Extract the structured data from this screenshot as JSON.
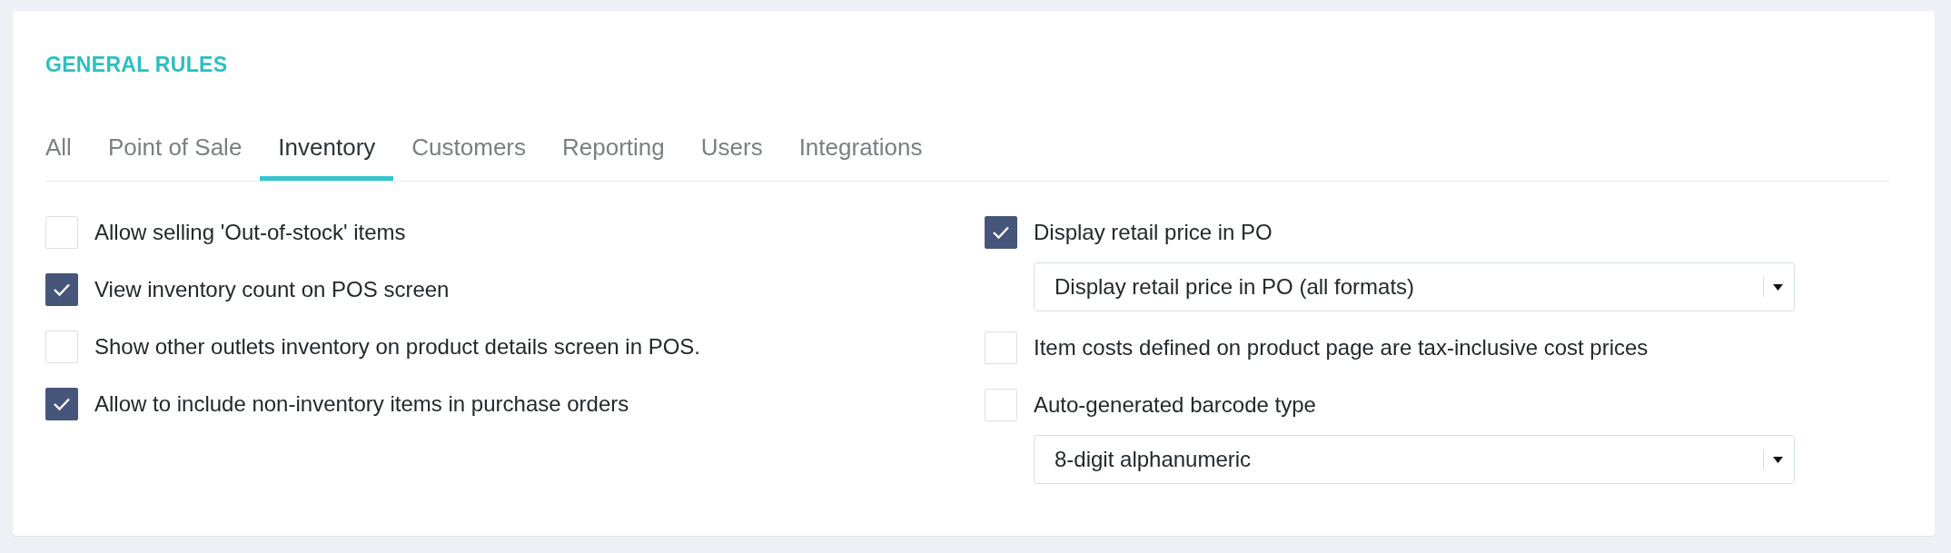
{
  "title": "GENERAL RULES",
  "tabs": [
    {
      "label": "All",
      "selected": false
    },
    {
      "label": "Point of Sale",
      "selected": false
    },
    {
      "label": "Inventory",
      "selected": true
    },
    {
      "label": "Customers",
      "selected": false
    },
    {
      "label": "Reporting",
      "selected": false
    },
    {
      "label": "Users",
      "selected": false
    },
    {
      "label": "Integrations",
      "selected": false
    }
  ],
  "left_options": [
    {
      "label": "Allow selling 'Out-of-stock' items",
      "checked": false
    },
    {
      "label": "View inventory count on POS screen",
      "checked": true
    },
    {
      "label": "Show other outlets inventory on product details screen in POS.",
      "checked": false
    },
    {
      "label": "Allow to include non-inventory items in purchase orders",
      "checked": true
    }
  ],
  "right_options": [
    {
      "label": "Display retail price in PO",
      "checked": true,
      "select": {
        "value": "Display retail price in PO (all formats)"
      }
    },
    {
      "label": "Item costs defined on product page are tax-inclusive cost prices",
      "checked": false
    },
    {
      "label": "Auto-generated barcode type",
      "checked": false,
      "select": {
        "value": "8-digit alphanumeric"
      }
    }
  ]
}
